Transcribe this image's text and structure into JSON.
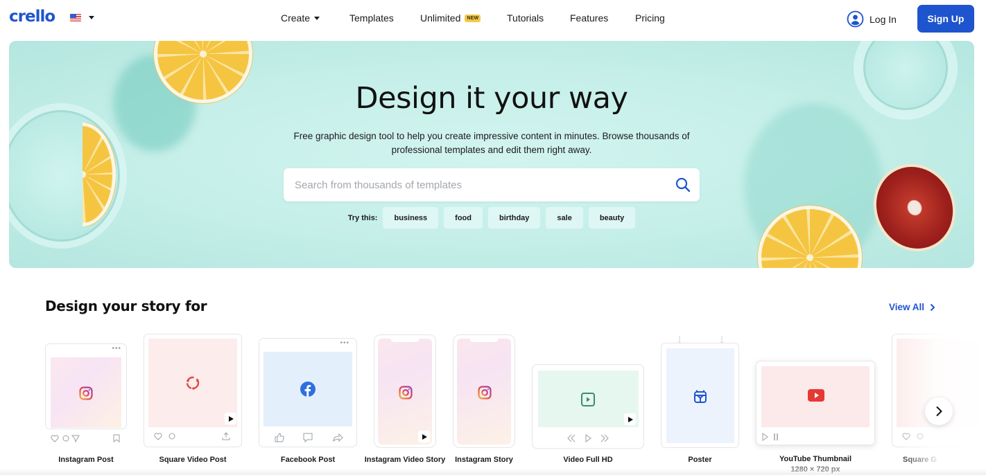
{
  "nav": {
    "logo": "crello",
    "language_icon": "us-flag-icon",
    "menu": [
      {
        "label": "Create",
        "has_dropdown": true
      },
      {
        "label": "Templates"
      },
      {
        "label": "Unlimited",
        "badge": "NEW"
      },
      {
        "label": "Tutorials"
      },
      {
        "label": "Features"
      },
      {
        "label": "Pricing"
      }
    ],
    "login_label": "Log In",
    "signup_label": "Sign Up"
  },
  "hero": {
    "title": "Design it your way",
    "subtitle": "Free graphic design tool to help you create impressive content in minutes. Browse thousands of professional templates and edit them right away.",
    "search": {
      "placeholder": "Search from thousands of templates",
      "value": ""
    },
    "try_label": "Try this:",
    "suggestions": [
      "business",
      "food",
      "birthday",
      "sale",
      "beauty"
    ]
  },
  "section": {
    "title": "Design your story for",
    "view_all": "View All"
  },
  "formats": [
    {
      "label": "Instagram Post",
      "icon": "instagram-icon"
    },
    {
      "label": "Square Video Post",
      "icon": "loop-icon"
    },
    {
      "label": "Facebook Post",
      "icon": "facebook-icon"
    },
    {
      "label": "Instagram Video Story",
      "icon": "instagram-icon"
    },
    {
      "label": "Instagram Story",
      "icon": "instagram-icon"
    },
    {
      "label": "Video Full HD",
      "icon": "video-play-icon"
    },
    {
      "label": "Poster",
      "icon": "poster-icon"
    },
    {
      "label": "YouTube Thumbnail",
      "sub": "1280 × 720 px",
      "icon": "youtube-icon"
    },
    {
      "label": "Square G",
      "icon": "loop-icon"
    }
  ],
  "colors": {
    "brand": "#1f54cf",
    "badge_new": "#f2c94c",
    "hero_bg": "#c6efe9"
  }
}
